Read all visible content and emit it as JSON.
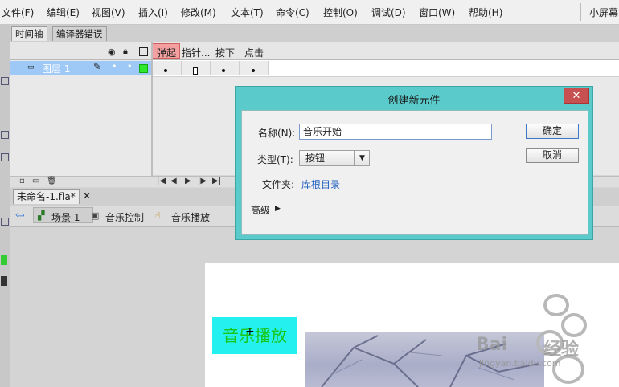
{
  "menu": [
    "文件(F)",
    "编辑(E)",
    "视图(V)",
    "插入(I)",
    "修改(M)",
    "文本(T)",
    "命令(C)",
    "控制(O)",
    "调试(D)",
    "窗口(W)",
    "帮助(H)"
  ],
  "workspace_label": "小屏幕",
  "panel_tabs": [
    "时间轴",
    "编译器错误"
  ],
  "layer": {
    "name": "图层 1"
  },
  "frame_labels": [
    "弹起",
    "指针...",
    "按下",
    "点击"
  ],
  "document_tab": "未命名-1.fla*",
  "breadcrumb": [
    "场景 1",
    "音乐控制",
    "音乐播放"
  ],
  "stage": {
    "button_text": "音乐播放"
  },
  "watermark": {
    "brand": "Bai",
    "brand2": "经验",
    "url": "jingyan.baidu.com"
  },
  "dialog": {
    "title": "创建新元件",
    "name_label": "名称(N):",
    "name_value": "音乐开始",
    "type_label": "类型(T):",
    "type_value": "按钮",
    "folder_label": "文件夹:",
    "folder_value": "库根目录",
    "advanced_label": "高级",
    "ok_label": "确定",
    "cancel_label": "取消",
    "close_glyph": "✕"
  },
  "colors": {
    "dialog_frame": "#5bcaca",
    "selected_layer": "#9ec9f7",
    "playhead": "#cc0000",
    "frame_label_highlight": "#f4a0a0",
    "stage_button_bg": "#24f0f0",
    "stage_button_text": "#18c818"
  }
}
